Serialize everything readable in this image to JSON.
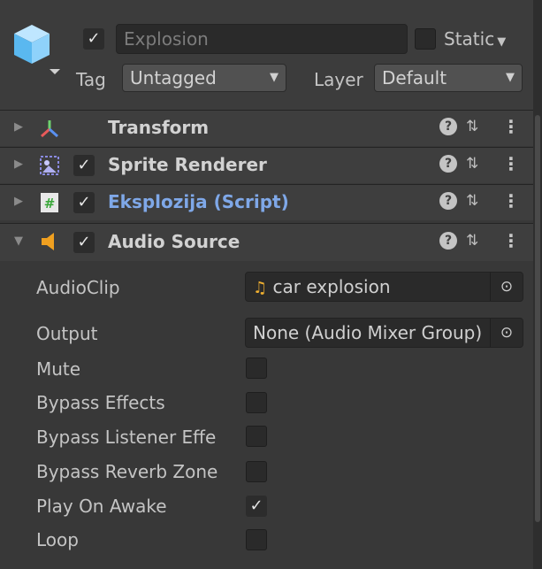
{
  "header": {
    "object_name": "Explosion",
    "active_checked": true,
    "static_label": "Static",
    "static_checked": false,
    "tag_label": "Tag",
    "tag_value": "Untagged",
    "layer_label": "Layer",
    "layer_value": "Default",
    "object_icon": "cube-icon"
  },
  "components": [
    {
      "title": "Transform",
      "icon": "transform-icon",
      "has_checkbox": false,
      "expanded": false
    },
    {
      "title": "Sprite Renderer",
      "icon": "sprite-renderer-icon",
      "has_checkbox": true,
      "expanded": false
    },
    {
      "title": "Eksplozija (Script)",
      "icon": "script-icon",
      "has_checkbox": true,
      "expanded": false
    },
    {
      "title": "Audio Source",
      "icon": "audio-source-icon",
      "has_checkbox": true,
      "expanded": true
    }
  ],
  "audio_source": {
    "audioclip_label": "AudioClip",
    "audioclip_value": "car explosion",
    "output_label": "Output",
    "output_value": "None (Audio Mixer Group)",
    "mute_label": "Mute",
    "mute": false,
    "bypass_effects_label": "Bypass Effects",
    "bypass_effects": false,
    "bypass_listener_label": "Bypass Listener Effe",
    "bypass_listener": false,
    "bypass_reverb_label": "Bypass Reverb Zone",
    "bypass_reverb": false,
    "play_on_awake_label": "Play On Awake",
    "play_on_awake": true,
    "loop_label": "Loop",
    "loop": false
  },
  "colors": {
    "panel_bg": "#383838",
    "header_bg": "#3c3c3c",
    "script_title": "#7fa8e8",
    "audio_icon": "#f0a020"
  }
}
